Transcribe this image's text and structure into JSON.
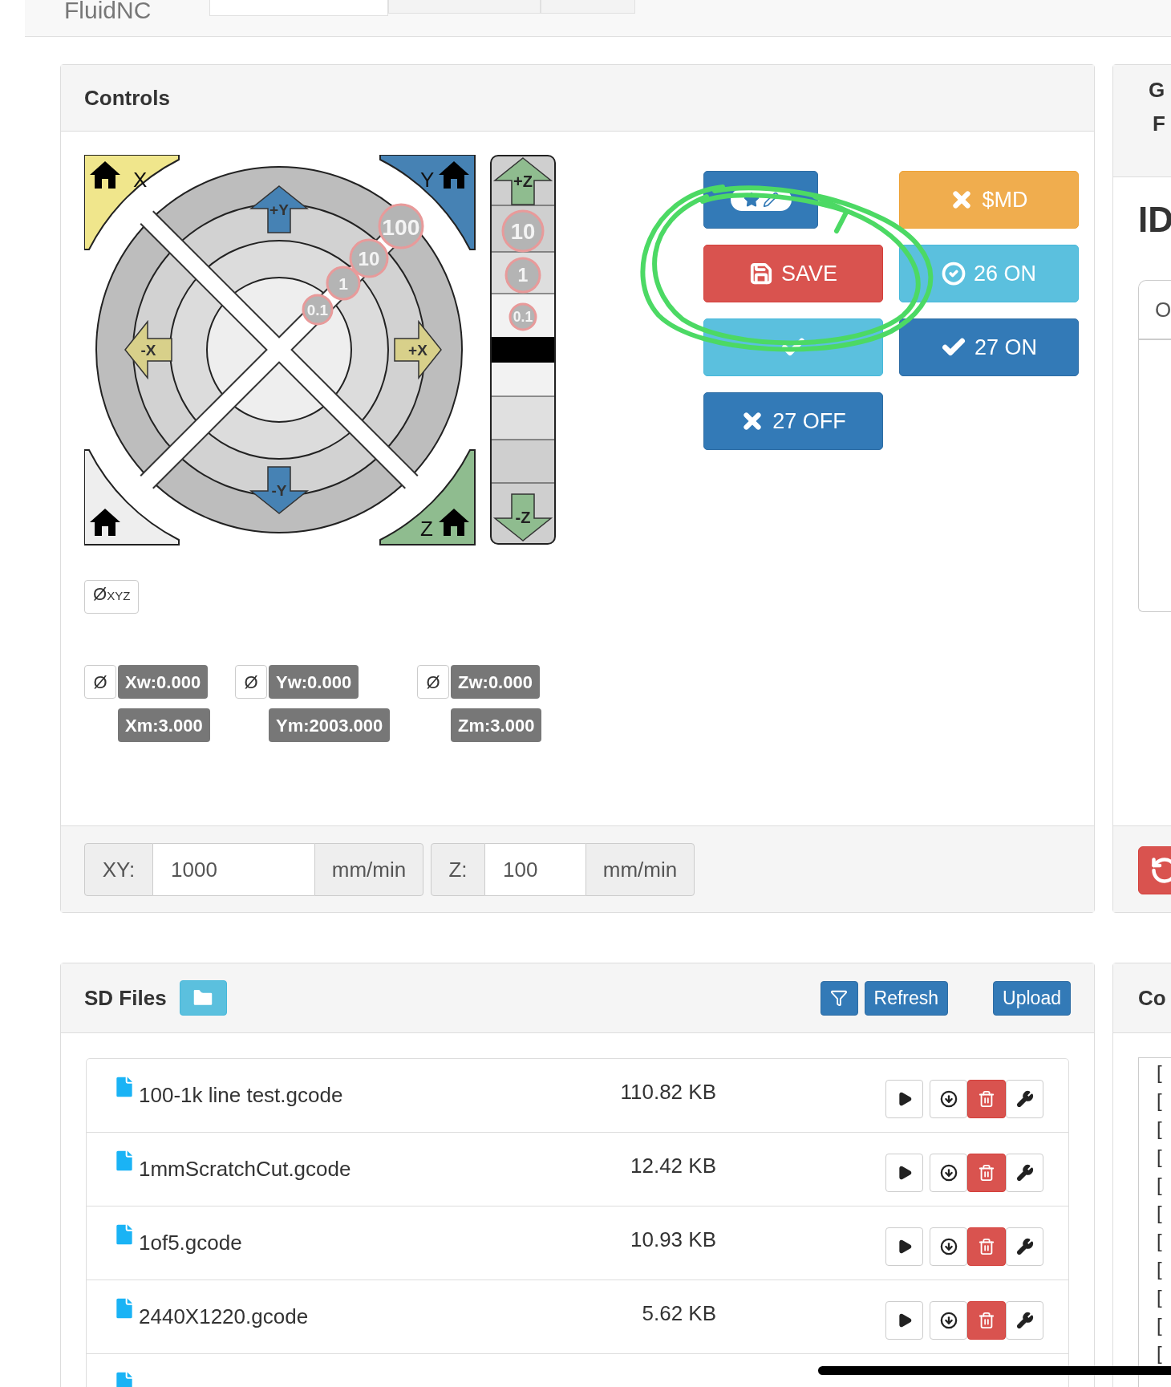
{
  "topbar": {
    "brand": "FluidNC",
    "tabs": [
      {
        "selected": true
      },
      {
        "selected": false
      },
      {
        "selected": false
      }
    ]
  },
  "controls": {
    "title": "Controls",
    "jog": {
      "home_labels": [
        "X",
        "Y",
        "Z"
      ],
      "arrows": [
        "+Y",
        "-X",
        "+X",
        "-Y"
      ],
      "xy_steps": [
        "100",
        "10",
        "1",
        "0.1"
      ],
      "z_arrows": [
        "+Z",
        "-Z"
      ],
      "z_steps": [
        "10",
        "1",
        "0.1"
      ]
    },
    "macros": [
      {
        "kind": "icon_only"
      },
      {
        "kind": "labeled",
        "label": "$MD"
      },
      {
        "kind": "labeled",
        "label": "SAVE"
      },
      {
        "kind": "labeled",
        "label": "26 ON"
      },
      {
        "kind": "icon_only"
      },
      {
        "kind": "labeled",
        "label": "27 ON"
      },
      {
        "kind": "labeled",
        "label": "27 OFF"
      }
    ],
    "zero_all": {
      "symbol": "Ø",
      "axes": "XYZ"
    },
    "axes": [
      {
        "zero": "Ø",
        "work": "Xw:0.000",
        "machine": "Xm:3.000"
      },
      {
        "zero": "Ø",
        "work": "Yw:0.000",
        "machine": "Ym:2003.000"
      },
      {
        "zero": "Ø",
        "work": "Zw:0.000",
        "machine": "Zm:3.000"
      }
    ],
    "feedrates": [
      {
        "label": "XY:",
        "value": "1000",
        "unit": "mm/min"
      },
      {
        "label": "Z:",
        "value": "100",
        "unit": "mm/min"
      }
    ]
  },
  "sd_files": {
    "title": "SD Files",
    "actions": [
      "Refresh",
      "Upload"
    ],
    "files": [
      {
        "name": "100-1k line test.gcode",
        "size": "110.82 KB"
      },
      {
        "name": "1mmScratchCut.gcode",
        "size": "12.42 KB"
      },
      {
        "name": "1of5.gcode",
        "size": "10.93 KB"
      },
      {
        "name": "2440X1220.gcode",
        "size": "5.62 KB"
      }
    ]
  },
  "side_panel": {
    "header_letters": [
      "G",
      "F"
    ],
    "heading": "ID",
    "field_text": "O"
  },
  "console_panel": {
    "title": "Co",
    "lines": [
      "[",
      "[",
      "[",
      "[",
      "[",
      "[",
      "[",
      "[",
      "[",
      "[",
      "["
    ]
  }
}
